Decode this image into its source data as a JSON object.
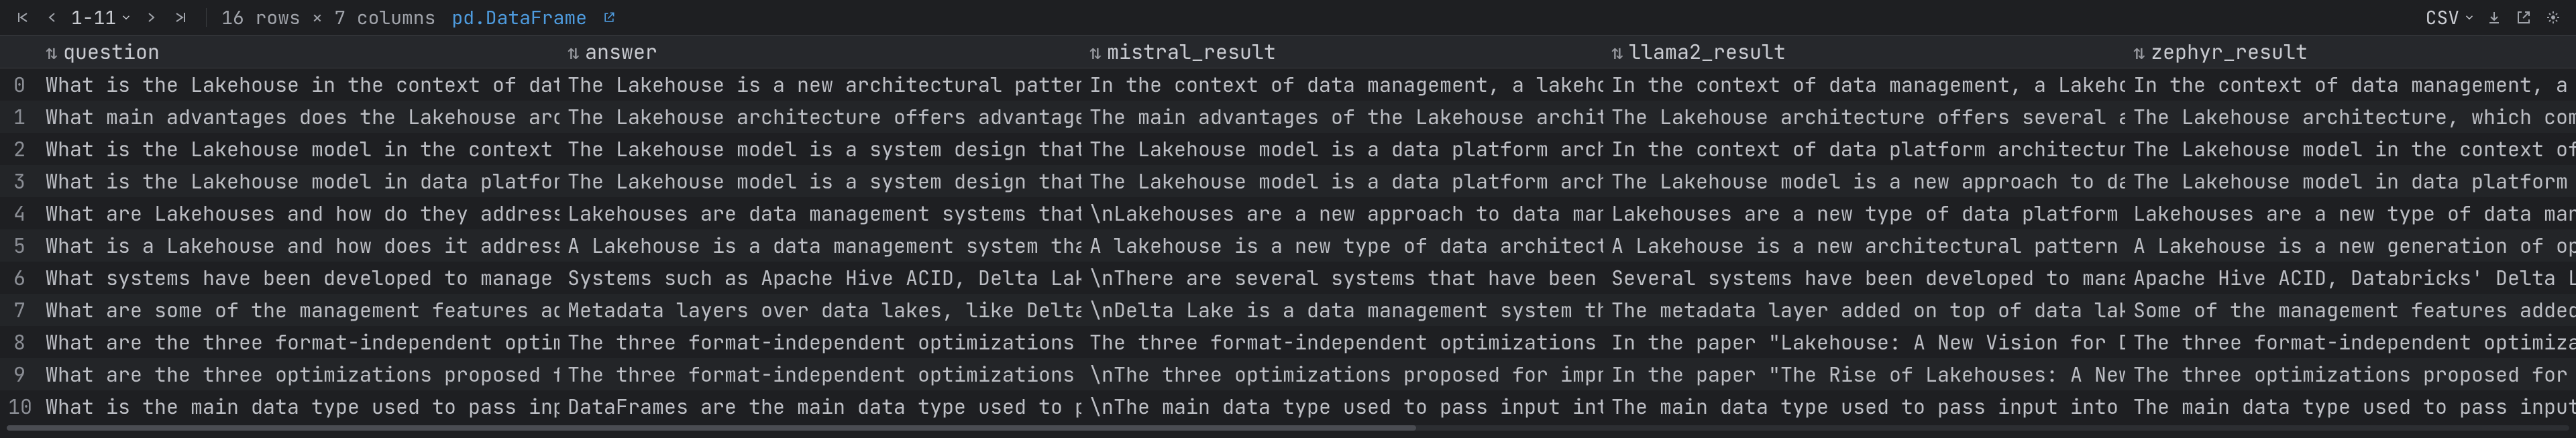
{
  "toolbar": {
    "range_label": "1-11",
    "dims_label": "16 rows × 7 columns",
    "type_label": "pd.DataFrame",
    "csv_label": "CSV"
  },
  "columns": [
    {
      "key": "question",
      "label": "question"
    },
    {
      "key": "answer",
      "label": "answer"
    },
    {
      "key": "mistral_result",
      "label": "mistral_result"
    },
    {
      "key": "llama2_result",
      "label": "llama2_result"
    },
    {
      "key": "zephyr_result",
      "label": "zephyr_result"
    }
  ],
  "rows": [
    {
      "idx": 0,
      "question": "What is the Lakehouse in the context of data m…",
      "answer": "The Lakehouse is a new architectural pattern i…",
      "mistral_result": " In the context of data management, a lakehouse…",
      "llama2_result": " In the context of data management, a Lakehous…",
      "zephyr_result": " In the context of data management, a Lakehous"
    },
    {
      "idx": 1,
      "question": "What main advantages does the Lakehouse archit…",
      "answer": "The Lakehouse architecture offers advantages s…",
      "mistral_result": " The main advantages of the Lakehouse archite…",
      "llama2_result": " The Lakehouse architecture offers several adv…",
      "zephyr_result": " The Lakehouse architecture, which combines th"
    },
    {
      "idx": 2,
      "question": "What is the Lakehouse model in the context of …",
      "answer": "The Lakehouse model is a system design that ai…",
      "mistral_result": " The Lakehouse model is a data platform archite…",
      "llama2_result": " In the context of data platform architectures…",
      "zephyr_result": " The Lakehouse model in the context of data pl"
    },
    {
      "idx": 3,
      "question": "What is the Lakehouse model in data platform a…",
      "answer": "The Lakehouse model is a system design that ai…",
      "mistral_result": " The Lakehouse model is a data platform archite…",
      "llama2_result": " The Lakehouse model is a new approach to data…",
      "zephyr_result": " The Lakehouse model in data platform architec"
    },
    {
      "idx": 4,
      "question": "What are Lakehouses and how do they address th…",
      "answer": "Lakehouses are data management systems that co…",
      "mistral_result": " \\nLakehouses are a new approach to data manageme…",
      "llama2_result": " Lakehouses are a new type of data platform ar…",
      "zephyr_result": " Lakehouses are a new type of data management"
    },
    {
      "idx": 5,
      "question": "What is a Lakehouse and how does it address th…",
      "answer": "A Lakehouse is a data management system that u…",
      "mistral_result": " A lakehouse is a new type of data architecture…",
      "llama2_result": " A Lakehouse is a new architectural pattern fo…",
      "zephyr_result": " A Lakehouse is a new generation of open data"
    },
    {
      "idx": 6,
      "question": "What systems have been developed to manage met…",
      "answer": "Systems such as Apache Hive ACID, Delta Lake, …",
      "mistral_result": " \\nThere are several systems that have been dev…",
      "llama2_result": " Several systems have been developed to manage…",
      "zephyr_result": " Apache Hive ACID, Databricks' Delta Lake, Apa"
    },
    {
      "idx": 7,
      "question": "What are some of the management features added…",
      "answer": "Metadata layers over data lakes, like Delta La…",
      "mistral_result": " \\nDelta Lake is a data management system that …",
      "llama2_result": " The metadata layer added on top of data lakes…",
      "zephyr_result": " Some of the management features added by meta"
    },
    {
      "idx": 8,
      "question": "What are the three format-independent optimiza…",
      "answer": "The three format-independent optimizations pro…",
      "mistral_result": " The three format-independent optimizations pro…",
      "llama2_result": " In the paper \"Lakehouse: A New Vision for Dat…",
      "zephyr_result": " The three format-independent optimizations pr"
    },
    {
      "idx": 9,
      "question": "What are the three optimizations proposed for …",
      "answer": "The three format-independent optimizations pro…",
      "mistral_result": " \\nThe three optimizations proposed for improvi…",
      "llama2_result": " In the paper \"The Rise of Lakehouses: A New A…",
      "zephyr_result": " The three optimizations proposed for improvin"
    },
    {
      "idx": 10,
      "question": "What is the main data type used to pass input …",
      "answer": "DataFrames are the main data type used to pass…",
      "mistral_result": " \\nThe main data type used to pass input into t…",
      "llama2_result": " The main data type used to pass input into th…",
      "zephyr_result": " The main data type used to pass input into th"
    }
  ]
}
